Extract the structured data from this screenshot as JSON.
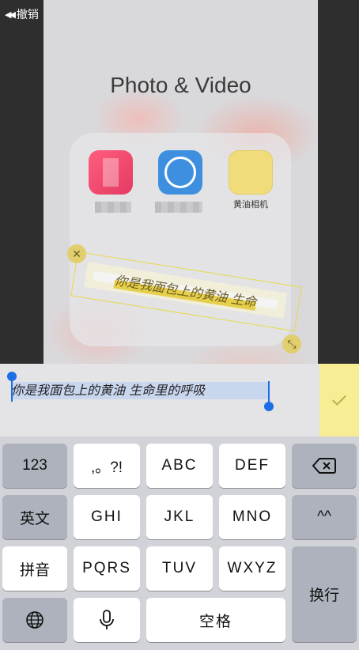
{
  "top_bar": {
    "undo_label": "撤销"
  },
  "folder": {
    "title": "Photo & Video",
    "apps": [
      {
        "name": "",
        "icon": "pink-app-icon"
      },
      {
        "name": "",
        "icon": "blue-camera-app-icon"
      },
      {
        "name": "黄油相机",
        "icon": "butter-camera-icon"
      }
    ]
  },
  "sticker": {
    "text": "你是我面包上的黄油 生命"
  },
  "input": {
    "text": "你是我面包上的黄油 生命里的呼吸"
  },
  "keyboard": {
    "row1": [
      "123",
      ",。?!",
      "ABC",
      "DEF",
      "⌫"
    ],
    "row2": [
      "英文",
      "GHI",
      "JKL",
      "MNO",
      "^^"
    ],
    "row3": [
      "拼音",
      "PQRS",
      "TUV",
      "WXYZ"
    ],
    "row4": [
      "🌐",
      "🎤",
      "空格"
    ],
    "return_label": "换行"
  },
  "colors": {
    "accent": "#1d6ee5",
    "confirm_bg": "#f6ed95",
    "sticker_border": "#e8d84a"
  }
}
